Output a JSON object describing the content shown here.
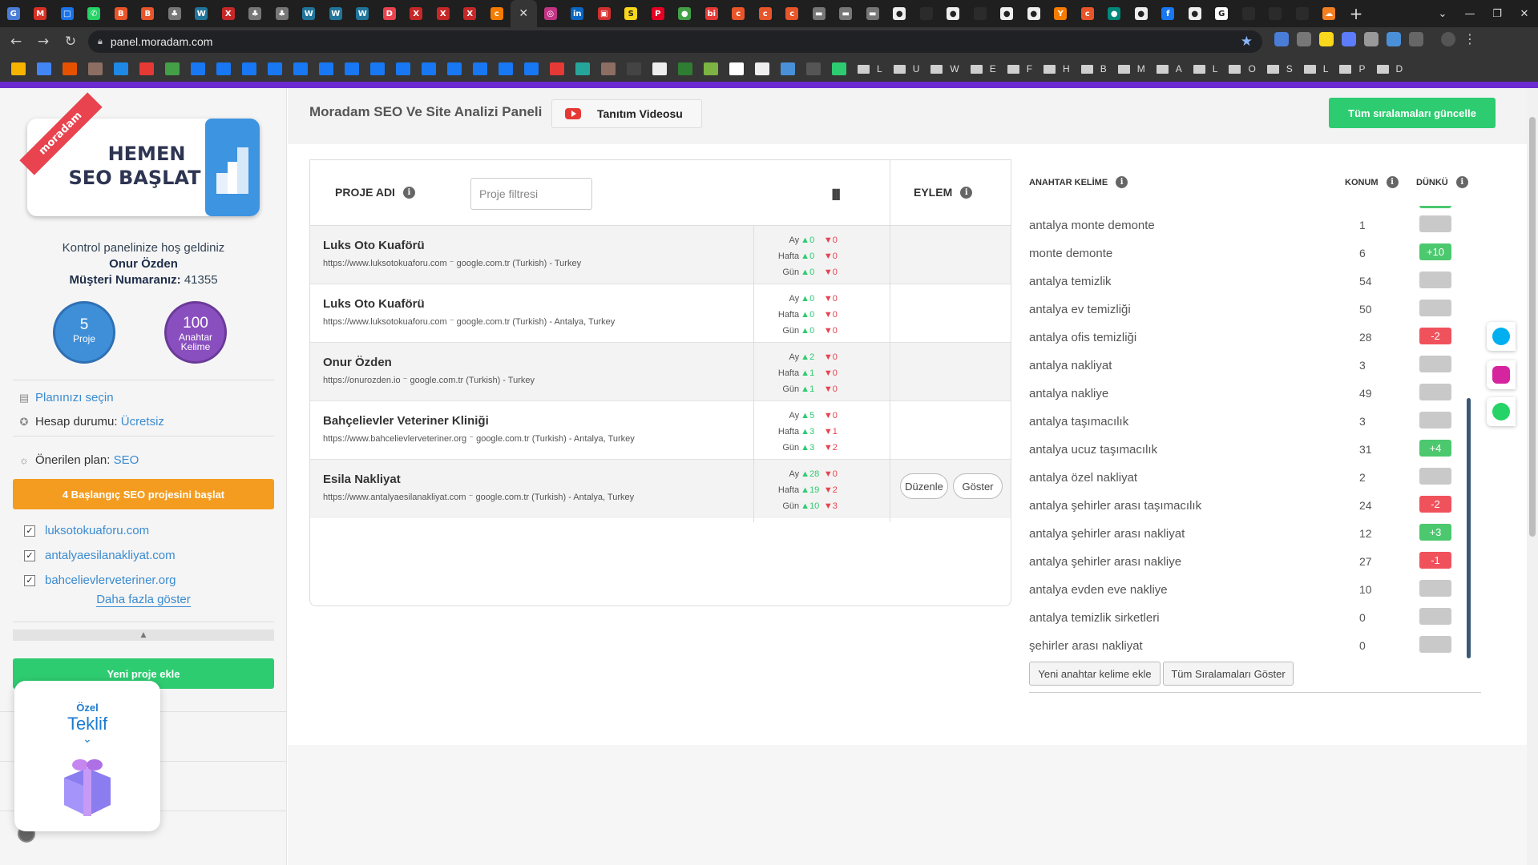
{
  "browser": {
    "url": "panel.moradam.com",
    "tabs": [
      {
        "name": "google-translate-tab",
        "color": "#4a7dd8",
        "glyph": "G"
      },
      {
        "name": "gmail-tab",
        "color": "#d93025",
        "glyph": "M"
      },
      {
        "name": "meet-tab",
        "color": "#1a73e8",
        "glyph": "□"
      },
      {
        "name": "whatsapp-tab",
        "color": "#25d366",
        "glyph": "✆"
      },
      {
        "name": "brave-tab",
        "color": "#e8552a",
        "glyph": "B"
      },
      {
        "name": "brave-tab-2",
        "color": "#e8552a",
        "glyph": "B"
      },
      {
        "name": "generic-tab",
        "color": "#777777",
        "glyph": "♣"
      },
      {
        "name": "wordpress-tab",
        "color": "#21759b",
        "glyph": "W"
      },
      {
        "name": "x-tab",
        "color": "#c62828",
        "glyph": "X"
      },
      {
        "name": "generic-tab-2",
        "color": "#777777",
        "glyph": "♣"
      },
      {
        "name": "generic-tab-3",
        "color": "#777777",
        "glyph": "♣"
      },
      {
        "name": "wordpress-tab-2",
        "color": "#21759b",
        "glyph": "W"
      },
      {
        "name": "wordpress-tab-3",
        "color": "#21759b",
        "glyph": "W"
      },
      {
        "name": "wordpress-tab-4",
        "color": "#21759b",
        "glyph": "W"
      },
      {
        "name": "dh-tab",
        "color": "#e8434f",
        "glyph": "D"
      },
      {
        "name": "x-tab-2",
        "color": "#c62828",
        "glyph": "X"
      },
      {
        "name": "x-tab-3",
        "color": "#c62828",
        "glyph": "X"
      },
      {
        "name": "x-tab-4",
        "color": "#c62828",
        "glyph": "X"
      },
      {
        "name": "ck-tab",
        "color": "#f57c00",
        "glyph": "c"
      },
      {
        "name": "instagram-tab",
        "color": "#c13584",
        "glyph": "◎"
      },
      {
        "name": "linkedin-tab",
        "color": "#0a66c2",
        "glyph": "in"
      },
      {
        "name": "red-tab",
        "color": "#d32f2f",
        "glyph": "▣"
      },
      {
        "name": "s-tab",
        "color": "#f9d71c",
        "glyph": "S"
      },
      {
        "name": "pinterest-tab",
        "color": "#e60023",
        "glyph": "P"
      },
      {
        "name": "green-tab",
        "color": "#43a047",
        "glyph": "●"
      },
      {
        "name": "bi-tab",
        "color": "#e53935",
        "glyph": "bi"
      },
      {
        "name": "cp-tab",
        "color": "#e8552a",
        "glyph": "c"
      },
      {
        "name": "cp-tab-2",
        "color": "#e8552a",
        "glyph": "c"
      },
      {
        "name": "cp-tab-3",
        "color": "#e8552a",
        "glyph": "c"
      },
      {
        "name": "car-tab",
        "color": "#777777",
        "glyph": "▬"
      },
      {
        "name": "car-tab-2",
        "color": "#777777",
        "glyph": "▬"
      },
      {
        "name": "car-tab-3",
        "color": "#777777",
        "glyph": "▬"
      },
      {
        "name": "github-tab",
        "color": "#eeeeee",
        "glyph": "●"
      },
      {
        "name": "blank-tab",
        "color": "#2b2b2b",
        "glyph": ""
      },
      {
        "name": "github-tab-2",
        "color": "#eeeeee",
        "glyph": "●"
      },
      {
        "name": "blank-tab-2",
        "color": "#2b2b2b",
        "glyph": ""
      },
      {
        "name": "github-tab-3",
        "color": "#eeeeee",
        "glyph": "●"
      },
      {
        "name": "github-tab-4",
        "color": "#eeeeee",
        "glyph": "●"
      },
      {
        "name": "y-tab",
        "color": "#f57c00",
        "glyph": "Y"
      },
      {
        "name": "cp-tab-4",
        "color": "#e8552a",
        "glyph": "c"
      },
      {
        "name": "teal-tab",
        "color": "#00897b",
        "glyph": "●"
      },
      {
        "name": "github-tab-5",
        "color": "#eeeeee",
        "glyph": "●"
      },
      {
        "name": "facebook-tab",
        "color": "#1877f2",
        "glyph": "f"
      },
      {
        "name": "github-tab-6",
        "color": "#eeeeee",
        "glyph": "●"
      },
      {
        "name": "google-tab",
        "color": "#ffffff",
        "glyph": "G"
      },
      {
        "name": "blank-tab-3",
        "color": "#2b2b2b",
        "glyph": ""
      },
      {
        "name": "blank-tab-4",
        "color": "#2b2b2b",
        "glyph": ""
      },
      {
        "name": "blank-tab-5",
        "color": "#2b2b2b",
        "glyph": ""
      },
      {
        "name": "cloud-tab",
        "color": "#f38020",
        "glyph": "☁"
      }
    ],
    "bookmark_folders": [
      "L",
      "U",
      "W",
      "E",
      "F",
      "H",
      "B",
      "M",
      "A",
      "L",
      "O",
      "S",
      "L",
      "P",
      "D"
    ]
  },
  "sidebar": {
    "banner_line1": "HEMEN",
    "banner_line2": "SEO BAŞLAT",
    "banner_ribbon": "moradam",
    "welcome": "Kontrol panelinize hoş geldiniz",
    "user_name": "Onur Özden",
    "customer_label": "Müşteri Numaranız:",
    "customer_number": "41355",
    "projects_count": "5",
    "projects_label": "Proje",
    "keywords_count": "100",
    "keywords_label_1": "Anahtar",
    "keywords_label_2": "Kelime",
    "plan_select": "Planınızı seçin",
    "account_label": "Hesap durumu:",
    "account_value": "Ücretsiz",
    "suggested_label": "Önerilen plan:",
    "suggested_value": "SEO",
    "start_button": "4 Başlangıç SEO projesini başlat",
    "sites": [
      "luksotokuaforu.com",
      "antalyaesilanakliyat.com",
      "bahcelievlerveteriner.org"
    ],
    "show_more": "Daha fazla göster",
    "new_project": "Yeni proje ekle",
    "offer_1": "Özel",
    "offer_2": "Teklif"
  },
  "header": {
    "title": "Moradam SEO Ve Site Analizi Paneli",
    "video_button": "Tanıtım Videosu",
    "update_button": "Tüm sıralamaları güncelle"
  },
  "projects": {
    "col_name": "PROJE ADI",
    "filter_placeholder": "Proje filtresi",
    "col_action": "EYLEM",
    "stat_labels": [
      "Ay",
      "Hafta",
      "Gün"
    ],
    "rows": [
      {
        "name": "Luks Oto Kuaförü",
        "url": "https://www.luksotokuaforu.com",
        "engine": "google.com.tr (Turkish) - Turkey",
        "stats": [
          [
            "0",
            "0"
          ],
          [
            "0",
            "0"
          ],
          [
            "0",
            "0"
          ]
        ]
      },
      {
        "name": "Luks Oto Kuaförü",
        "url": "https://www.luksotokuaforu.com",
        "engine": "google.com.tr (Turkish) - Antalya, Turkey",
        "stats": [
          [
            "0",
            "0"
          ],
          [
            "0",
            "0"
          ],
          [
            "0",
            "0"
          ]
        ]
      },
      {
        "name": "Onur Özden",
        "url": "https://onurozden.io",
        "engine": "google.com.tr (Turkish) - Turkey",
        "stats": [
          [
            "2",
            "0"
          ],
          [
            "1",
            "0"
          ],
          [
            "1",
            "0"
          ]
        ]
      },
      {
        "name": "Bahçelievler Veteriner Kliniği",
        "url": "https://www.bahcelievlerveteriner.org",
        "engine": "google.com.tr (Turkish) - Antalya, Turkey",
        "stats": [
          [
            "5",
            "0"
          ],
          [
            "3",
            "1"
          ],
          [
            "3",
            "2"
          ]
        ]
      },
      {
        "name": "Esila Nakliyat",
        "url": "https://www.antalyaesilanakliyat.com",
        "engine": "google.com.tr (Turkish) - Antalya, Turkey",
        "stats": [
          [
            "28",
            "0"
          ],
          [
            "19",
            "2"
          ],
          [
            "10",
            "3"
          ]
        ]
      }
    ],
    "edit_button": "Düzenle",
    "show_button": "Göster"
  },
  "keywords": {
    "col_keyword": "ANAHTAR KELİME",
    "col_position": "KONUM",
    "col_daily": "DÜNKÜ",
    "rows": [
      {
        "keyword": "antalya monte demonte",
        "position": "1",
        "change": ""
      },
      {
        "keyword": "monte demonte",
        "position": "6",
        "change": "+10"
      },
      {
        "keyword": "antalya temizlik",
        "position": "54",
        "change": ""
      },
      {
        "keyword": "antalya ev temizliği",
        "position": "50",
        "change": ""
      },
      {
        "keyword": "antalya ofis temizliği",
        "position": "28",
        "change": "-2"
      },
      {
        "keyword": "antalya nakliyat",
        "position": "3",
        "change": ""
      },
      {
        "keyword": "antalya nakliye",
        "position": "49",
        "change": ""
      },
      {
        "keyword": "antalya taşımacılık",
        "position": "3",
        "change": ""
      },
      {
        "keyword": "antalya ucuz taşımacılık",
        "position": "31",
        "change": "+4"
      },
      {
        "keyword": "antalya özel nakliyat",
        "position": "2",
        "change": ""
      },
      {
        "keyword": "antalya şehirler arası taşımacılık",
        "position": "24",
        "change": "-2"
      },
      {
        "keyword": "antalya şehirler arası nakliyat",
        "position": "12",
        "change": "+3"
      },
      {
        "keyword": "antalya şehirler arası nakliye",
        "position": "27",
        "change": "-1"
      },
      {
        "keyword": "antalya evden eve nakliye",
        "position": "10",
        "change": ""
      },
      {
        "keyword": "antalya temizlik sirketleri",
        "position": "0",
        "change": ""
      },
      {
        "keyword": "şehirler arası nakliyat",
        "position": "0",
        "change": ""
      }
    ],
    "add_button": "Yeni anahtar kelime ekle",
    "show_all_button": "Tüm Sıralamaları Göster"
  },
  "colors": {
    "accent_green": "#2ecc71",
    "accent_orange": "#f39c1f",
    "accent_purple": "#6b2bd1",
    "link_blue": "#3a8bd0",
    "up_green": "#2ecc71",
    "down_red": "#e8434f"
  }
}
